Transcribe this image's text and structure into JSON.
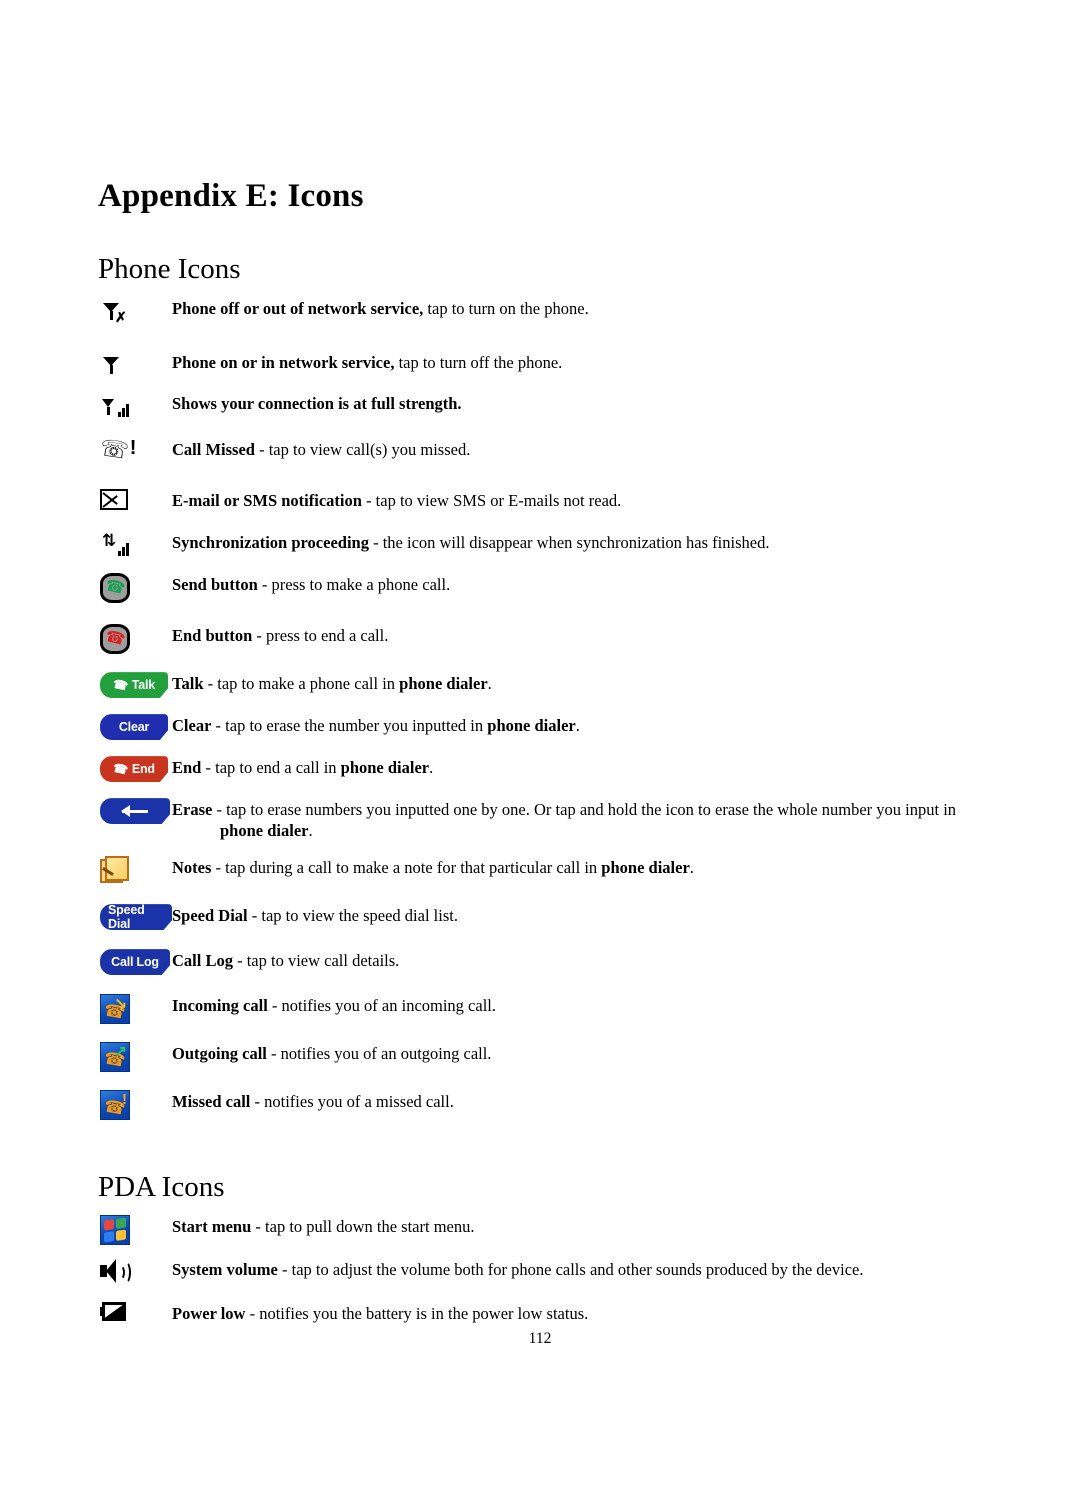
{
  "document": {
    "title": "Appendix E: Icons",
    "page_number": "112"
  },
  "sections": [
    {
      "heading": "Phone Icons",
      "rows": [
        {
          "icon": "phone-off-antenna-icon",
          "label": "Phone off or out of network service",
          "separator": ",",
          "description": " tap to turn on the phone."
        },
        {
          "icon": "phone-on-antenna-icon",
          "label": "Phone on or in network service",
          "separator": ",",
          "description": " tap to turn off the phone."
        },
        {
          "icon": "signal-full-strength-icon",
          "label": "Shows your connection is at full strength.",
          "separator": "",
          "description": ""
        },
        {
          "icon": "call-missed-handset-icon",
          "label": "Call Missed",
          "separator": " -",
          "description": " tap to view call(s) you missed."
        },
        {
          "icon": "envelope-icon",
          "label": "E-mail or SMS notification",
          "separator": " -",
          "description": " tap to view SMS or E-mails not read."
        },
        {
          "icon": "synchronization-icon",
          "label": "Synchronization proceeding",
          "separator": " -",
          "description": " the icon will disappear when synchronization has finished."
        },
        {
          "icon": "send-button-icon",
          "label": "Send button",
          "separator": " -",
          "description": " press to make a phone call."
        },
        {
          "icon": "end-button-icon",
          "label": "End button",
          "separator": " -",
          "description": " press to end a call."
        },
        {
          "icon": "talk-pill-icon",
          "icon_label": "Talk",
          "label": "Talk",
          "separator": " -",
          "description": " tap to make a phone call in ",
          "description_bold": "phone dialer",
          "description_tail": "."
        },
        {
          "icon": "clear-pill-icon",
          "icon_label": "Clear",
          "label": "Clear",
          "separator": " -",
          "description": " tap to erase the number you inputted in ",
          "description_bold": "phone dialer",
          "description_tail": "."
        },
        {
          "icon": "end-pill-icon",
          "icon_label": "End",
          "label": "End",
          "separator": " -",
          "description": " tap to end a call in ",
          "description_bold": "phone dialer",
          "description_tail": "."
        },
        {
          "icon": "erase-arrow-pill-icon",
          "label": "Erase",
          "separator": " -",
          "description": " tap to erase numbers you inputted one by one. Or tap and hold the icon to erase the whole number you input in",
          "description_bold": "phone dialer",
          "description_tail": ".",
          "wrapped": true
        },
        {
          "icon": "notes-icon",
          "label": "Notes",
          "separator": " -",
          "description": " tap during a call to make a note for that particular call in ",
          "description_bold": "phone dialer",
          "description_tail": "."
        },
        {
          "icon": "speed-dial-pill-icon",
          "icon_label": "Speed Dial",
          "label": "Speed Dial",
          "separator": " -",
          "description": " tap to view the speed dial list."
        },
        {
          "icon": "call-log-pill-icon",
          "icon_label": "Call Log",
          "label": "Call Log",
          "separator": " -",
          "description": " tap to view call details."
        },
        {
          "icon": "incoming-call-icon",
          "label": "Incoming call",
          "separator": " -",
          "description": " notifies you of an incoming call."
        },
        {
          "icon": "outgoing-call-icon",
          "label": "Outgoing call",
          "separator": " -",
          "description": " notifies you of an outgoing call."
        },
        {
          "icon": "missed-call-icon",
          "label": "Missed call",
          "separator": " -",
          "description": " notifies you of a missed call."
        }
      ]
    },
    {
      "heading": "PDA Icons",
      "rows": [
        {
          "icon": "start-menu-icon",
          "label": "Start menu",
          "separator": " -",
          "description": " tap to pull down the start menu."
        },
        {
          "icon": "system-volume-icon",
          "label": "System volume",
          "separator": " -",
          "description": " tap to adjust the volume both for phone calls and other sounds produced by the device."
        },
        {
          "icon": "power-low-icon",
          "label": "Power low",
          "separator": " -",
          "description": " notifies you the battery is in the power low status."
        }
      ]
    }
  ],
  "colors": {
    "talk_green": "#21A03C",
    "clear_blue": "#1E2EAE",
    "end_red": "#C8341E",
    "pill_blue": "#1B33A8",
    "icon_blue": "#0B47B6",
    "handset_orange": "#EF9A19"
  }
}
